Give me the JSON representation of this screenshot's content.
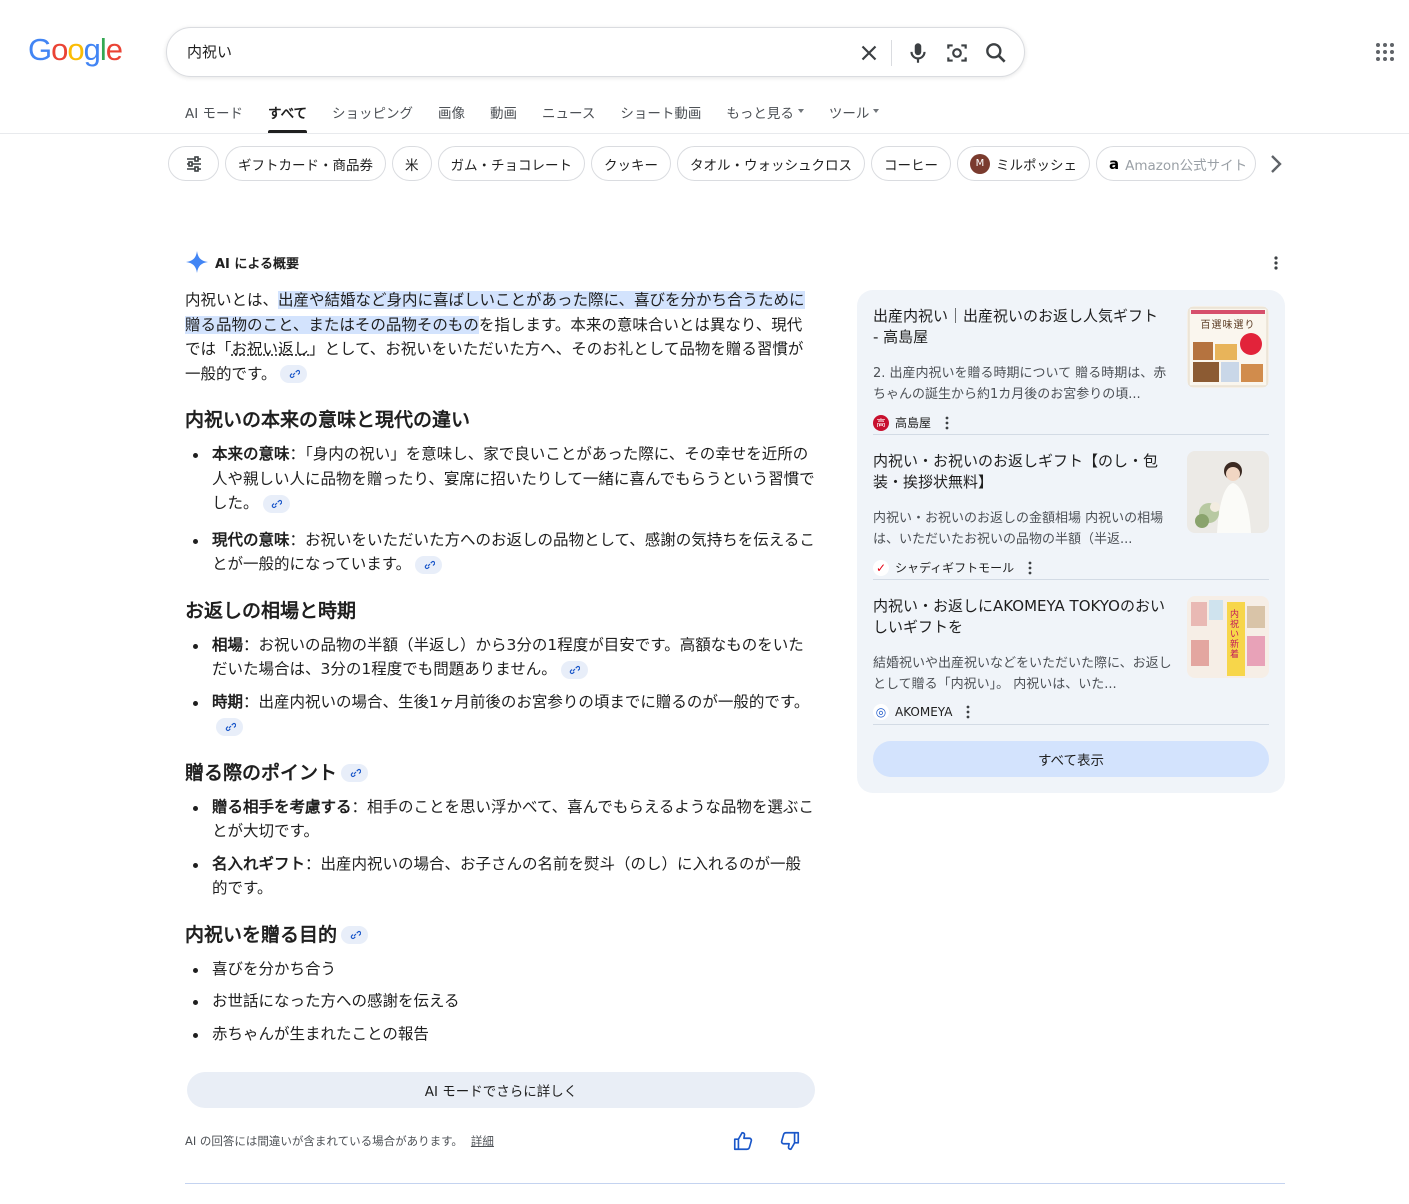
{
  "search": {
    "query": "内祝い"
  },
  "tabs": [
    {
      "label": "AI モード"
    },
    {
      "label": "すべて"
    },
    {
      "label": "ショッピング"
    },
    {
      "label": "画像"
    },
    {
      "label": "動画"
    },
    {
      "label": "ニュース"
    },
    {
      "label": "ショート動画"
    },
    {
      "label": "もっと見る"
    },
    {
      "label": "ツール"
    }
  ],
  "chips": [
    {
      "label": "ギフトカード・商品券"
    },
    {
      "label": "米"
    },
    {
      "label": "ガム・チョコレート"
    },
    {
      "label": "クッキー"
    },
    {
      "label": "タオル・ウォッシュクロス"
    },
    {
      "label": "コーヒー"
    },
    {
      "label": "ミルポッシェ"
    },
    {
      "label": "Amazon公式サイト"
    }
  ],
  "ai_overview": {
    "header": "AI による概要",
    "intro_pre": "内祝いとは、",
    "intro_hl": "出産や結婚など身内に喜ばしいことがあった際に、喜びを分かち合うために贈る品物のこと、またはその品物そのもの",
    "intro_mid": "を指します。本来の意味合いとは異なり、現代では「",
    "intro_ul": "お祝い返し",
    "intro_post": "」として、お祝いをいただいた方へ、そのお礼として品物を贈る習慣が一般的です。",
    "sections": [
      {
        "heading": "内祝いの本来の意味と現代の違い",
        "items": [
          {
            "bold": "本来の意味",
            "text": "：「身内の祝い」を意味し、家で良いことがあった際に、その幸せを近所の人や親しい人に品物を贈ったり、宴席に招いたりして一緒に喜んでもらうという習慣でした。"
          },
          {
            "bold": "現代の意味",
            "text": "：お祝いをいただいた方へのお返しの品物として、感謝の気持ちを伝えることが一般的になっています。"
          }
        ]
      },
      {
        "heading": "お返しの相場と時期",
        "items": [
          {
            "bold": "相場",
            "text": "：お祝いの品物の半額（半返し）から3分の1程度が目安です。高額なものをいただいた場合は、3分の1程度でも問題ありません。"
          },
          {
            "bold": "時期",
            "text": "：出産内祝いの場合、生後1ヶ月前後のお宮参りの頃までに贈るのが一般的です。"
          }
        ]
      },
      {
        "heading": "贈る際のポイント",
        "items": [
          {
            "bold": "贈る相手を考慮する",
            "text": "：相手のことを思い浮かべて、喜んでもらえるような品物を選ぶことが大切です。"
          },
          {
            "bold": "名入れギフト",
            "text": "：出産内祝いの場合、お子さんの名前を熨斗（のし）に入れるのが一般的です。"
          }
        ]
      },
      {
        "heading": "内祝いを贈る目的",
        "items": [
          {
            "text": "喜びを分かち合う"
          },
          {
            "text": "お世話になった方への感謝を伝える"
          },
          {
            "text": "赤ちゃんが生まれたことの報告"
          }
        ]
      }
    ],
    "more_button": "AI モードでさらに詳しく",
    "disclaimer": "AI の回答には間違いが含まれている場合があります。",
    "details_link": "詳細"
  },
  "sources": [
    {
      "title": "出産内祝い｜出産祝いのお返し人気ギフト - 高島屋",
      "snippet": "2. 出産内祝いを贈る時期について 贈る時期は、赤ちゃんの誕生から約1カ月後のお宮参りの頃...",
      "site": "高島屋",
      "fav_glyph": "高",
      "fav_color": "#c8102e",
      "img_text": "百選味選り"
    },
    {
      "title": "内祝い・お祝いのお返しギフト【のし・包装・挨拶状無料】",
      "snippet": "内祝い・お祝いのお返しの金額相場 内祝いの相場は、いただいたお祝いの品物の半額（半返...",
      "site": "シャディギフトモール",
      "fav_glyph": "✓",
      "fav_color": "#e60012"
    },
    {
      "title": "内祝い・お返しにAKOMEYA TOKYOのおいしいギフトを",
      "snippet": "結婚祝いや出産祝いなどをいただいた際に、お返しとして贈る「内祝い」。 内祝いは、いた...",
      "site": "AKOMEYA",
      "fav_glyph": "◎",
      "fav_color": "#1a57c9",
      "img_text": "内祝い新着"
    }
  ],
  "show_all": "すべて表示",
  "colors": {
    "google_blue": "#4285f4",
    "google_red": "#ea4335",
    "google_yellow": "#fbbc05",
    "google_green": "#34a853",
    "highlight": "#d3e3fd",
    "panel_bg": "#f0f4f9"
  }
}
